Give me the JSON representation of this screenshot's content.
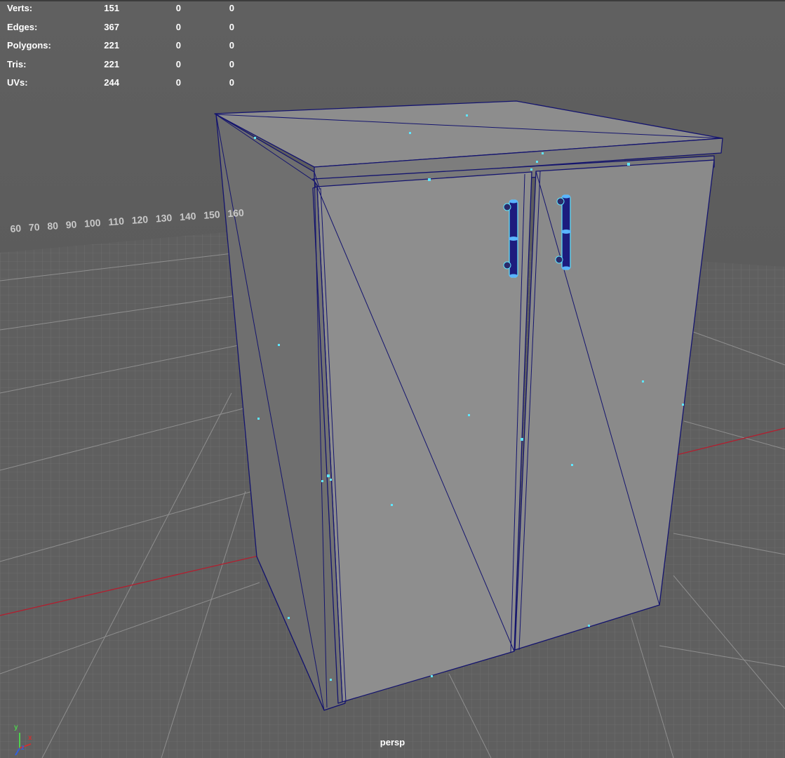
{
  "hud": {
    "stats": [
      {
        "label": "Verts:",
        "values": [
          "151",
          "0",
          "0"
        ]
      },
      {
        "label": "Edges:",
        "values": [
          "367",
          "0",
          "0"
        ]
      },
      {
        "label": "Polygons:",
        "values": [
          "221",
          "0",
          "0"
        ]
      },
      {
        "label": "Tris:",
        "values": [
          "221",
          "0",
          "0"
        ]
      },
      {
        "label": "UVs:",
        "values": [
          "244",
          "0",
          "0"
        ]
      }
    ]
  },
  "grid_labels": [
    "60",
    "70",
    "80",
    "90",
    "100",
    "110",
    "120",
    "130",
    "140",
    "150",
    "160"
  ],
  "camera": {
    "name": "persp"
  },
  "axis_gizmo": {
    "y": "y",
    "x": "x",
    "z": "z"
  },
  "colors": {
    "wireframe": "#14146e",
    "vertex": "#5ee6ff",
    "x_axis": "#b02030",
    "selection_accent": "#5ab4ff"
  }
}
